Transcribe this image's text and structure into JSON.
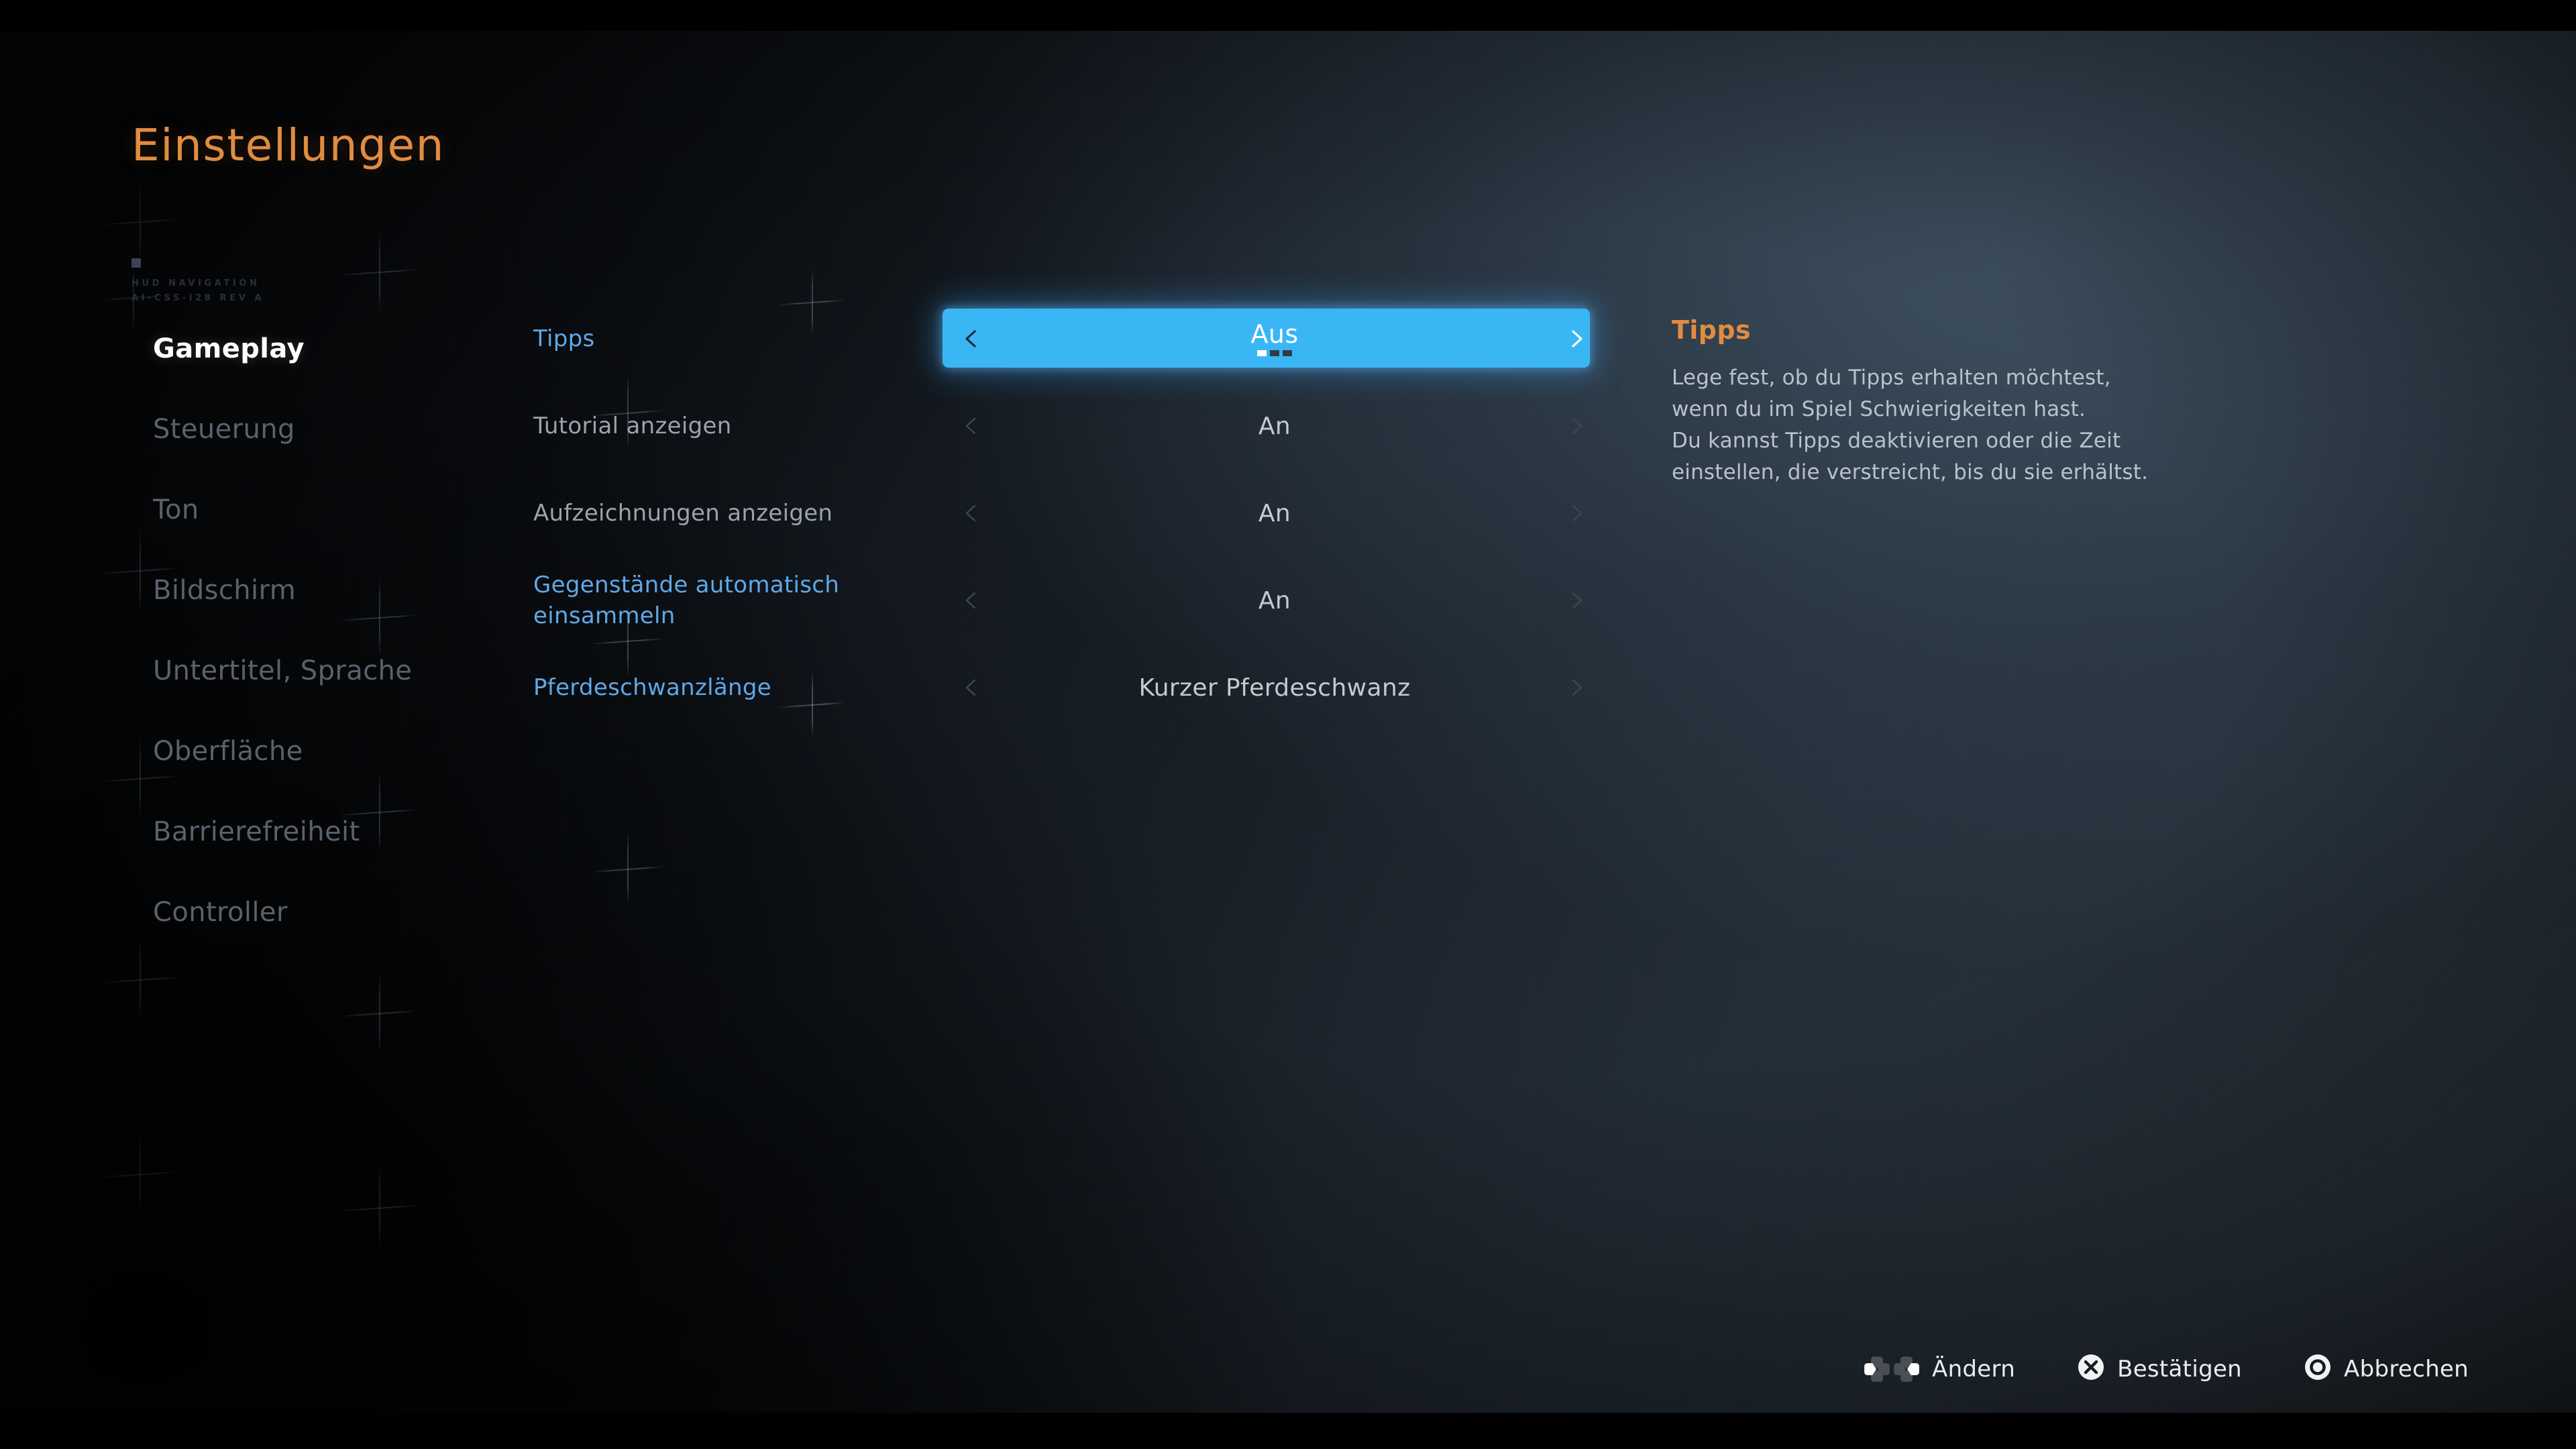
{
  "page": {
    "title": "Einstellungen",
    "tech_mark_line1": "HUD NAVIGATION",
    "tech_mark_line2": "AI-CSS-I28 REV A",
    "accent_orange": "#e08c42",
    "accent_blue": "#3ab6f5",
    "label_blue": "#5fa8e8",
    "background": "#2b3440"
  },
  "sidebar": {
    "items": [
      {
        "label": "Gameplay",
        "active": true
      },
      {
        "label": "Steuerung",
        "active": false
      },
      {
        "label": "Ton",
        "active": false
      },
      {
        "label": "Bildschirm",
        "active": false
      },
      {
        "label": "Untertitel, Sprache",
        "active": false
      },
      {
        "label": "Oberfläche",
        "active": false
      },
      {
        "label": "Barrierefreiheit",
        "active": false
      },
      {
        "label": "Controller",
        "active": false
      }
    ]
  },
  "settings": {
    "rows": [
      {
        "label": "Tipps",
        "value": "Aus",
        "label_color": "blue",
        "active": true,
        "steps_total": 3,
        "steps_index": 1
      },
      {
        "label": "Tutorial anzeigen",
        "value": "An",
        "label_color": "grey",
        "active": false
      },
      {
        "label": "Aufzeichnungen anzeigen",
        "value": "An",
        "label_color": "grey",
        "active": false
      },
      {
        "label": "Gegenstände automatisch einsammeln",
        "value": "An",
        "label_color": "blue",
        "active": false
      },
      {
        "label": "Pferdeschwanzlänge",
        "value": "Kurzer Pferdeschwanz",
        "label_color": "blue",
        "active": false
      }
    ]
  },
  "description": {
    "title": "Tipps",
    "body": "Lege fest, ob du Tipps erhalten möchtest,\nwenn du im Spiel Schwierigkeiten hast.\nDu kannst Tipps deaktivieren oder die Zeit\neinstellen, die verstreicht, bis du sie erhältst."
  },
  "prompts": {
    "items": [
      {
        "label": "Ändern",
        "icon": "dpad-left-right-icon"
      },
      {
        "label": "Bestätigen",
        "icon": "cross-button-icon"
      },
      {
        "label": "Abbrechen",
        "icon": "circle-button-icon"
      }
    ]
  }
}
